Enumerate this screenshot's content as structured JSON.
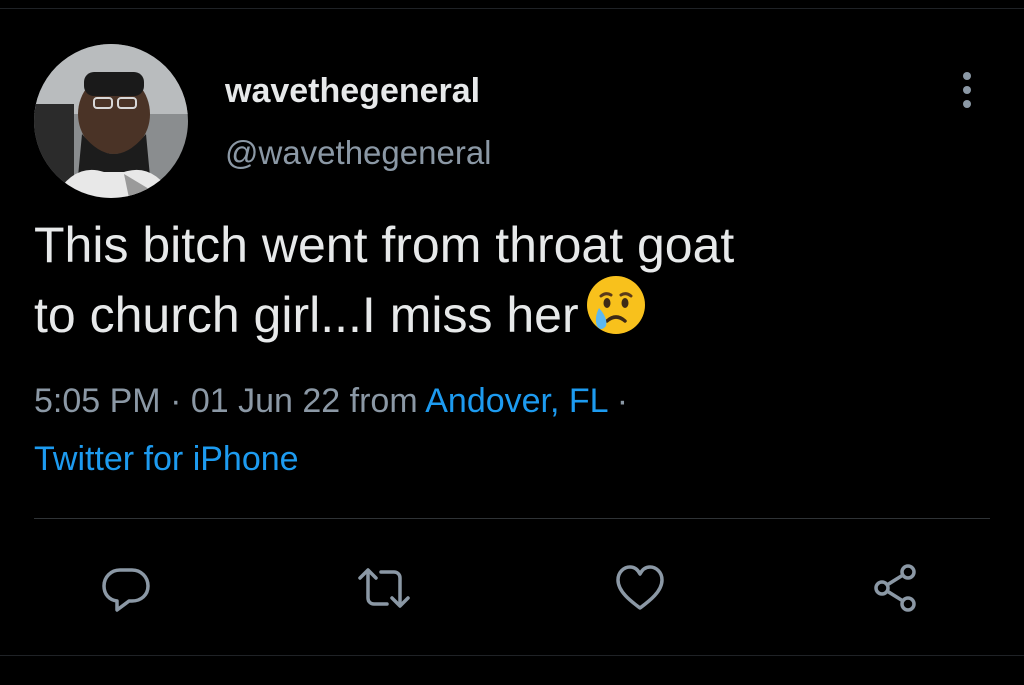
{
  "user": {
    "display_name": "wavethegeneral",
    "handle": "@wavethegeneral"
  },
  "tweet": {
    "line1": "This bitch went from throat goat",
    "line2": "to church girl...I miss her",
    "emoji": "crying-face-emoji"
  },
  "meta": {
    "time": "5:05 PM",
    "sep1": " · ",
    "date": "01 Jun 22",
    "from_word": " from ",
    "location": "Andover, FL",
    "sep2": " ·",
    "source": "Twitter for iPhone"
  },
  "actions": {
    "reply_icon": "reply-icon",
    "retweet_icon": "retweet-icon",
    "like_icon": "heart-icon",
    "share_icon": "share-icon"
  },
  "colors": {
    "background": "#000000",
    "primary_text": "#e7e9ea",
    "secondary_text": "#8b98a5",
    "accent": "#1d9bf0"
  }
}
